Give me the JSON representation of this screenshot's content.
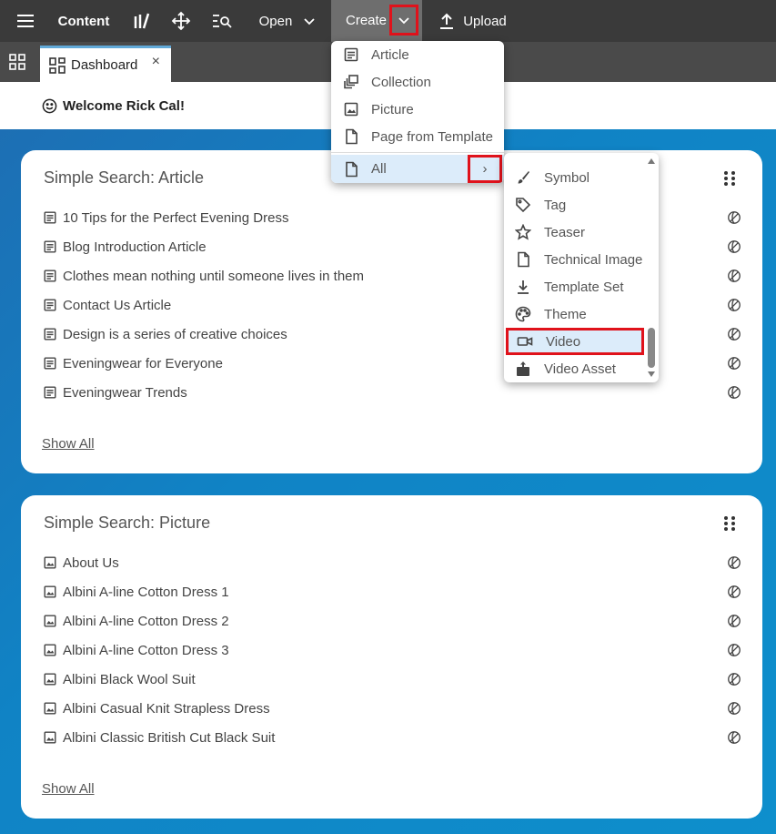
{
  "topbar": {
    "content_label": "Content",
    "open_label": "Open",
    "create_label": "Create",
    "upload_label": "Upload"
  },
  "tabs": {
    "dashboard_label": "Dashboard",
    "close_glyph": "×"
  },
  "welcome": {
    "text": "Welcome Rick Cal!"
  },
  "create_menu": {
    "items": [
      {
        "label": "Article",
        "icon": "article-icon"
      },
      {
        "label": "Collection",
        "icon": "collection-icon"
      },
      {
        "label": "Picture",
        "icon": "picture-icon"
      },
      {
        "label": "Page from Template",
        "icon": "page-icon"
      }
    ],
    "all_label": "All",
    "all_arrow": "›"
  },
  "all_submenu": {
    "items": [
      {
        "label": "Symbol",
        "icon": "brush-icon"
      },
      {
        "label": "Tag",
        "icon": "tag-icon"
      },
      {
        "label": "Teaser",
        "icon": "star-icon"
      },
      {
        "label": "Technical Image",
        "icon": "file-icon"
      },
      {
        "label": "Template Set",
        "icon": "download-icon"
      },
      {
        "label": "Theme",
        "icon": "palette-icon"
      },
      {
        "label": "Video",
        "icon": "video-icon",
        "highlighted": true
      },
      {
        "label": "Video Asset",
        "icon": "video-asset-icon"
      }
    ]
  },
  "panels": {
    "article": {
      "title": "Simple Search: Article",
      "show_all": "Show All",
      "rows": [
        "10 Tips for the Perfect Evening Dress",
        "Blog Introduction Article",
        "Clothes mean nothing until someone lives in them",
        "Contact Us Article",
        "Design is a series of creative choices",
        "Eveningwear for Everyone",
        "Eveningwear Trends"
      ]
    },
    "picture": {
      "title": "Simple Search: Picture",
      "show_all": "Show All",
      "rows": [
        "About Us",
        "Albini A-line Cotton Dress 1",
        "Albini A-line Cotton Dress 2",
        "Albini A-line Cotton Dress 3",
        "Albini Black Wool Suit",
        "Albini Casual Knit Strapless Dress",
        "Albini Classic British Cut Black Suit"
      ]
    }
  },
  "colors": {
    "topbar": "#3a3a3a",
    "tabbar": "#4a4a4a",
    "create_button": "#6e6e6e",
    "highlight": "#e0121b",
    "selection": "#dcecfa",
    "background_gradient_start": "#1d6fb4",
    "background_gradient_end": "#0e8fcc"
  }
}
